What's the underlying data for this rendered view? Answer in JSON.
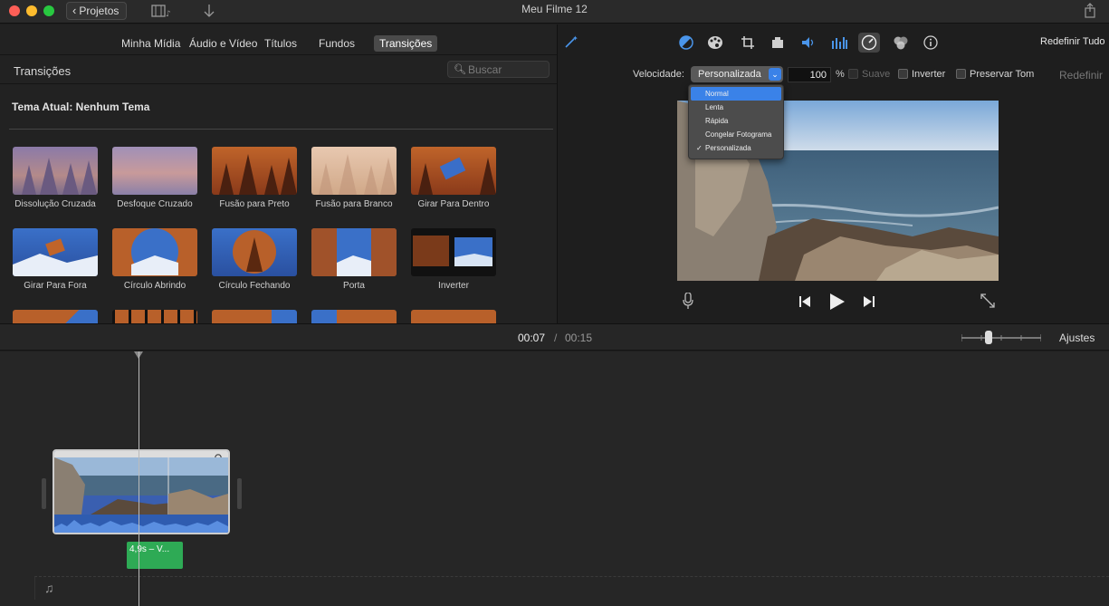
{
  "window": {
    "title": "Meu Filme 12",
    "back_label": "Projetos"
  },
  "tabs": [
    "Minha Mídia",
    "Áudio e Vídeo",
    "Títulos",
    "Fundos",
    "Transições"
  ],
  "browser": {
    "title": "Transições",
    "search_placeholder": "Buscar",
    "theme_label": "Tema Atual: Nenhum Tema",
    "transitions": [
      "Dissolução Cruzada",
      "Desfoque Cruzado",
      "Fusão para Preto",
      "Fusão para Branco",
      "Girar Para Dentro",
      "Girar Para Fora",
      "Círculo Abrindo",
      "Círculo Fechando",
      "Porta",
      "Inverter"
    ]
  },
  "viewer": {
    "reset_all": "Redefinir Tudo",
    "speed_label": "Velocidade:",
    "speed_value": "Personalizada",
    "speed_percent": "100",
    "percent_sign": "%",
    "smooth_label": "Suave",
    "reverse_label": "Inverter",
    "preserve_label": "Preservar Tom",
    "reset_label": "Redefinir",
    "speed_options": [
      "Normal",
      "Lenta",
      "Rápida",
      "Congelar Fotograma",
      "Personalizada"
    ],
    "speed_highlighted": "Normal",
    "speed_checked": "Personalizada",
    "check_mark": "✓"
  },
  "timeline": {
    "current_time": "00:07",
    "separator": "/",
    "total_time": "00:15",
    "adjust_label": "Ajustes",
    "audio_clip_label": "4,9s – V..."
  },
  "colors": {
    "accent": "#3a82e8",
    "audio_green": "#2eaa55",
    "clip_blue": "#3a5fb0"
  }
}
